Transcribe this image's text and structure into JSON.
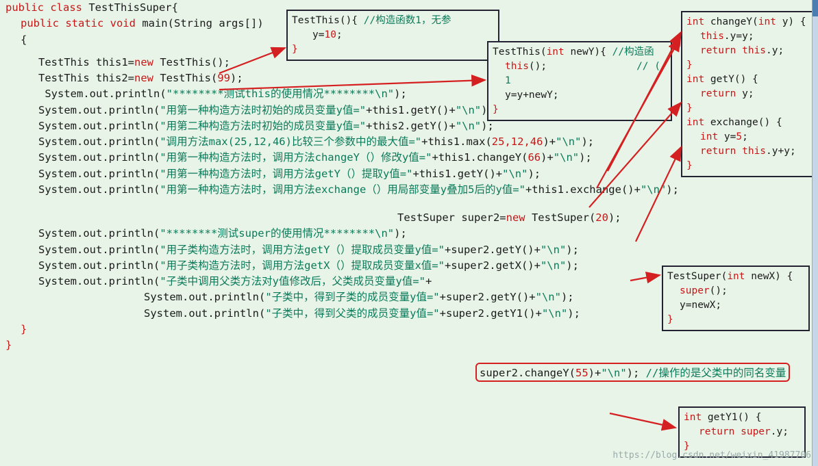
{
  "main": {
    "l1_kw1": "public class ",
    "l1_id": "TestThisSuper",
    "l1_p": "{",
    "l2_kw": "public static void ",
    "l2_id": "main",
    "l2_p1": "(",
    "l2_t": "String ",
    "l2_arg": "args[]",
    "l2_p2": ")",
    "lb": "{",
    "l4a": "TestThis this1=",
    "l4n": "new ",
    "l4b": "TestThis();",
    "l5a": "TestThis this2=",
    "l5n": "new ",
    "l5b": "TestThis(",
    "l5num": "99",
    "l5c": ");",
    "p6a": "System.out.println(",
    "p6s": "\"********测试this的使用情况********\\n\"",
    "p6b": ");",
    "p7a": "System.out.println(",
    "p7s": "\"用第一种构造方法时初始的成员变量y值=\"",
    "p7b": "+this1.getY()+",
    "p7n": "\"\\n\"",
    "p7c": ");",
    "p8a": "System.out.println(",
    "p8s": "\"用第二种构造方法时初始的成员变量y值=\"",
    "p8b": "+this2.getY()+",
    "p8n": "\"\\n\"",
    "p8c": ");",
    "p9a": "System.out.println(",
    "p9s": "\"调用方法max(25,12,46)比较三个参数中的最大值=\"",
    "p9b": "+this1.max(",
    "p9nums": "25,12,46",
    "p9b2": ")+",
    "p9n": "\"\\n\"",
    "p9c": ");",
    "p10a": "System.out.println(",
    "p10s": "\"用第一种构造方法时，调用方法changeY（）修改y值=\"",
    "p10b": "+this1.changeY(",
    "p10num": "66",
    "p10b2": ")+",
    "p10n": "\"\\n\"",
    "p10c": ");",
    "p11a": "System.out.println(",
    "p11s": "\"用第一种构造方法时，调用方法getY（）提取y值=\"",
    "p11b": "+this1.getY()+",
    "p11n": "\"\\n\"",
    "p11c": ");",
    "p12a": "System.out.println(",
    "p12s": "\"用第一种构造方法时，调用方法exchange（）用局部变量y叠加5后的y值=\"",
    "p12b": "+this1.exchange()+",
    "p12n": "\"\\n\"",
    "p12c": ");",
    "ts_a": "TestSuper super2=",
    "ts_n": "new ",
    "ts_b": "TestSuper(",
    "ts_num": "20",
    "ts_c": ");",
    "p14a": "System.out.println(",
    "p14s": "\"********测试super的使用情况********\\n\"",
    "p14b": ");",
    "p15a": "System.out.println(",
    "p15s": "\"用子类构造方法时，调用方法getY（）提取成员变量y值=\"",
    "p15b": "+super2.getY()+",
    "p15n": "\"\\n\"",
    "p15c": ");",
    "p16a": "System.out.println(",
    "p16s": "\"用子类构造方法时，调用方法getX（）提取成员变量x值=\"",
    "p16b": "+super2.getX()+",
    "p16n": "\"\\n\"",
    "p16c": ");",
    "p17a": "System.out.println(",
    "p17s": "\"子类中调用父类方法对y值修改后，父类成员变量y值=\"",
    "p17b": "+",
    "rbx": "super2.changeY(",
    "rbxn": "55",
    "rbx2": ")+",
    "rbxs": "\"\\n\"",
    "rbx3": ");  ",
    "rbxc": "//操作的是父类中的同名变量",
    "p18a": "System.out.println(",
    "p18s": "\"子类中，得到子类的成员变量y值=\"",
    "p18b": "+super2.getY()+",
    "p18n": "\"\\n\"",
    "p18c": ");",
    "p19a": "System.out.println(",
    "p19s": "\"子类中，得到父类的成员变量y值=\"",
    "p19b": "+super2.getY1()+",
    "p19n": "\"\\n\"",
    "p19c": ");",
    "rb": "}",
    "rb2": "}"
  },
  "box1": {
    "a": "TestThis(){    ",
    "c": "//构造函数1，无参",
    "b": "y=",
    "bn": "10",
    "bc": ";",
    "d": "}"
  },
  "box2": {
    "a": "TestThis(",
    "ap": "int ",
    "an": "newY",
    "ac": "){  ",
    "cmt": "//构造函",
    "b": "this",
    "bp": "();",
    "bsp": "               ",
    "bc": "//   ( 1",
    "c": "y=y+newY;",
    "d": "}"
  },
  "box3": {
    "a_kw": "int ",
    "a_id": "changeY(",
    "a_kw2": "int ",
    "a_p": "y) {",
    "b_kw": "this",
    "b_p": ".y=y;",
    "c_kw": "return this",
    "c_p": ".y;",
    "d": "}",
    "e_kw": "int ",
    "e_id": "getY() {",
    "f_kw": "return ",
    "f_p": "y;",
    "g": "}",
    "h_kw": "int ",
    "h_id": "exchange() {",
    "i_kw": "int ",
    "i_p": "y=",
    "i_n": "5",
    "i_c": ";",
    "j_kw": "return this",
    "j_p": ".y+y;",
    "k": "}"
  },
  "box4": {
    "a_id": "TestSuper(",
    "a_kw": "int ",
    "a_p": "newX) {",
    "b_kw": "super",
    "b_p": "();",
    "c": "y=newX;",
    "d": "}"
  },
  "box5": {
    "a_kw": "int ",
    "a_id": "getY1() {",
    "b_kw": "return super",
    "b_p": ".y;",
    "c": "}"
  },
  "wm": "https://blog.csdn.net/weixin_41987706"
}
